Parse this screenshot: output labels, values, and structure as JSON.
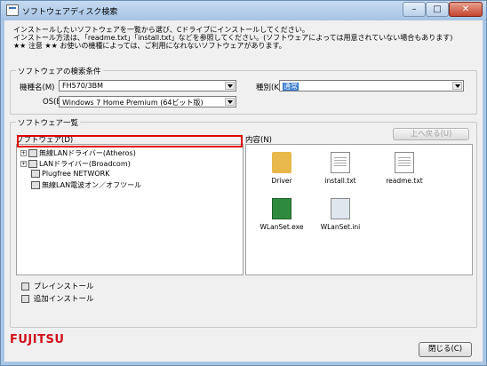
{
  "window": {
    "title": "ソフトウェアディスク検索"
  },
  "titlebar_buttons": {
    "minimize": "–",
    "maximize": "□",
    "close": "✕"
  },
  "intro": {
    "line1": "インストールしたいソフトウェアを一覧から選び、Cドライブにインストールしてください。",
    "line2": "インストール方法は、「readme.txt」「install.txt」などを参照してください。(ソフトウェアによっては用意されていない場合もあります)",
    "line3": "★★ 注意 ★★ お使いの機種によっては、ご利用になれないソフトウェアがあります。"
  },
  "search_group": {
    "legend": "ソフトウェアの検索条件",
    "model_label": "機種名(M)",
    "model_value": "FH570/3BM",
    "os_label": "OS(E)",
    "os_value": "Windows 7 Home Premium (64ビット版)",
    "type_label": "種別(K)",
    "type_value": "通常"
  },
  "list_group": {
    "legend": "ソフトウェア一覧",
    "software_header": "ソフトウェア(D)",
    "content_header": "内容(N)",
    "up_button": "上へ戻る(U)"
  },
  "tree": [
    {
      "label": "無線LANドライバー(Atheros)",
      "expandable": true
    },
    {
      "label": "LANドライバー(Broadcom)",
      "expandable": true
    },
    {
      "label": "Plugfree NETWORK",
      "expandable": false
    },
    {
      "label": "無線LAN電波オン／オフツール",
      "expandable": false
    }
  ],
  "files": [
    {
      "name": "Driver",
      "icon": "folder-icon"
    },
    {
      "name": "install.txt",
      "icon": "text-file-icon"
    },
    {
      "name": "readme.txt",
      "icon": "text-file-icon"
    },
    {
      "name": "WLanSet.exe",
      "icon": "chip-exe-icon"
    },
    {
      "name": "WLanSet.ini",
      "icon": "settings-file-icon"
    }
  ],
  "legend": {
    "preinstall": "プレインストール",
    "additional": "追加インストール"
  },
  "footer": {
    "brand": "FUJITSU",
    "close_button": "閉じる(C)"
  },
  "colors": {
    "highlight_box": "#e00000",
    "brand": "#d0121b",
    "selection": "#3377cc"
  }
}
